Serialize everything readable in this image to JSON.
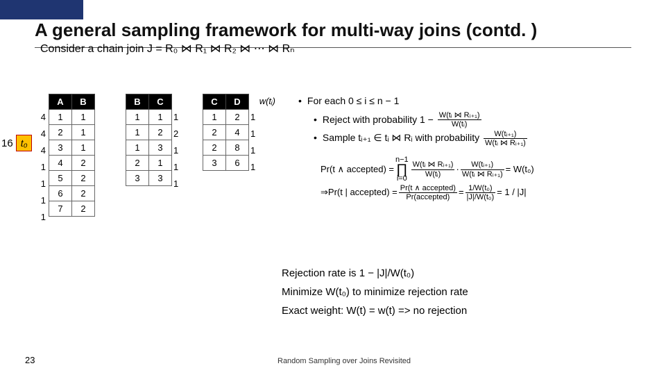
{
  "slide": {
    "title": "A general sampling framework for multi-way joins (contd. )",
    "number": "23",
    "footer": "Random Sampling over Joins Revisited"
  },
  "consider": "Consider a chain join J = R₀ ⋈ R₁ ⋈ R₂ ⋈ ⋯ ⋈ Rₙ",
  "t0": {
    "count": "16",
    "label": "t₀"
  },
  "tables": {
    "AB": {
      "headers": [
        "A",
        "B"
      ],
      "weights": [
        "4",
        "4",
        "4",
        "1",
        "1",
        "1",
        "1"
      ],
      "rows": [
        [
          "1",
          "1"
        ],
        [
          "2",
          "1"
        ],
        [
          "3",
          "1"
        ],
        [
          "4",
          "2"
        ],
        [
          "5",
          "2"
        ],
        [
          "6",
          "2"
        ],
        [
          "7",
          "2"
        ]
      ]
    },
    "BC": {
      "headers": [
        "B",
        "C"
      ],
      "weights": [
        "1",
        "2",
        "1",
        "1",
        "1"
      ],
      "rows": [
        [
          "1",
          "1"
        ],
        [
          "1",
          "2"
        ],
        [
          "1",
          "3"
        ],
        [
          "2",
          "1"
        ],
        [
          "3",
          "3"
        ]
      ]
    },
    "CD": {
      "headers": [
        "C",
        "D"
      ],
      "weights": [
        "1",
        "1",
        "1",
        "1"
      ],
      "wt_label": "w(tᵢ)",
      "rows": [
        [
          "1",
          "2"
        ],
        [
          "2",
          "4"
        ],
        [
          "2",
          "8"
        ],
        [
          "3",
          "6"
        ]
      ]
    }
  },
  "bullets": {
    "foreach": "For each 0 ≤ i ≤ n − 1",
    "reject_pre": "Reject with probability 1 − ",
    "reject_num": "W(tᵢ ⋈ Rᵢ₊₁)",
    "reject_den": "W(tᵢ)",
    "sample_pre": "Sample tᵢ₊₁ ∈ tᵢ ⋈ Rᵢ with probability ",
    "sample_num": "W(tᵢ₊₁)",
    "sample_den": "W(tᵢ ⋈ Rᵢ₊₁)"
  },
  "eq": {
    "pr_and_l": "Pr(t ∧ accepted) = ",
    "prod": "∏",
    "prod_top": "n−1",
    "prod_bot": "i=0",
    "fa_num": "W(tᵢ ⋈ Rᵢ₊₁)",
    "fa_den": "W(tᵢ)",
    "dot": " · ",
    "fb_num": "W(tᵢ₊₁)",
    "fb_den": "W(tᵢ ⋈ Rᵢ₊₁)",
    "eq_wt0": " = W(t₀)",
    "arrow": "⇒ ",
    "pr_cond": "Pr(t | accepted) = ",
    "c_num": "Pr(t ∧ accepted)",
    "c_den": "Pr(accepted)",
    "mid_num": "1/W(t₀)",
    "mid_den": "|J|/W(t₀)",
    "final": " = 1 / |J|"
  },
  "notes": {
    "l1": "Rejection rate is 1 − |J|/W(t₀)",
    "l2": "Minimize W(t₀) to minimize rejection rate",
    "l3": "Exact weight: W(t) = w(t) => no rejection"
  }
}
